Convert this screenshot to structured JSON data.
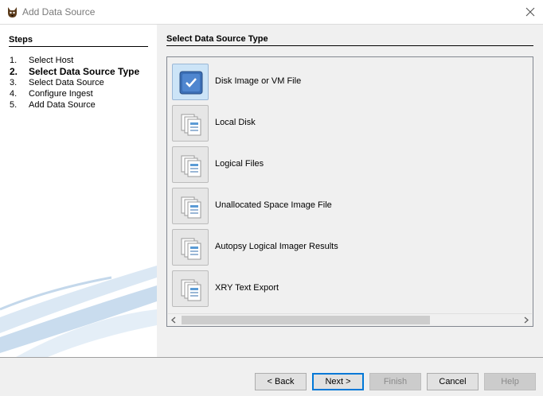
{
  "window": {
    "title": "Add Data Source"
  },
  "steps": {
    "title": "Steps",
    "items": [
      {
        "num": "1.",
        "label": "Select Host",
        "active": false
      },
      {
        "num": "2.",
        "label": "Select Data Source Type",
        "active": true
      },
      {
        "num": "3.",
        "label": "Select Data Source",
        "active": false
      },
      {
        "num": "4.",
        "label": "Configure Ingest",
        "active": false
      },
      {
        "num": "5.",
        "label": "Add Data Source",
        "active": false
      }
    ]
  },
  "main": {
    "title": "Select Data Source Type",
    "types": [
      {
        "label": "Disk Image or VM File",
        "selected": true
      },
      {
        "label": "Local Disk",
        "selected": false
      },
      {
        "label": "Logical Files",
        "selected": false
      },
      {
        "label": "Unallocated Space Image File",
        "selected": false
      },
      {
        "label": "Autopsy Logical Imager Results",
        "selected": false
      },
      {
        "label": "XRY Text Export",
        "selected": false
      }
    ]
  },
  "footer": {
    "back": "< Back",
    "next": "Next >",
    "finish": "Finish",
    "cancel": "Cancel",
    "help": "Help"
  },
  "colors": {
    "accent": "#0078d7",
    "selected_bg": "#cce4f7",
    "panel_bg": "#f0f0f0"
  }
}
